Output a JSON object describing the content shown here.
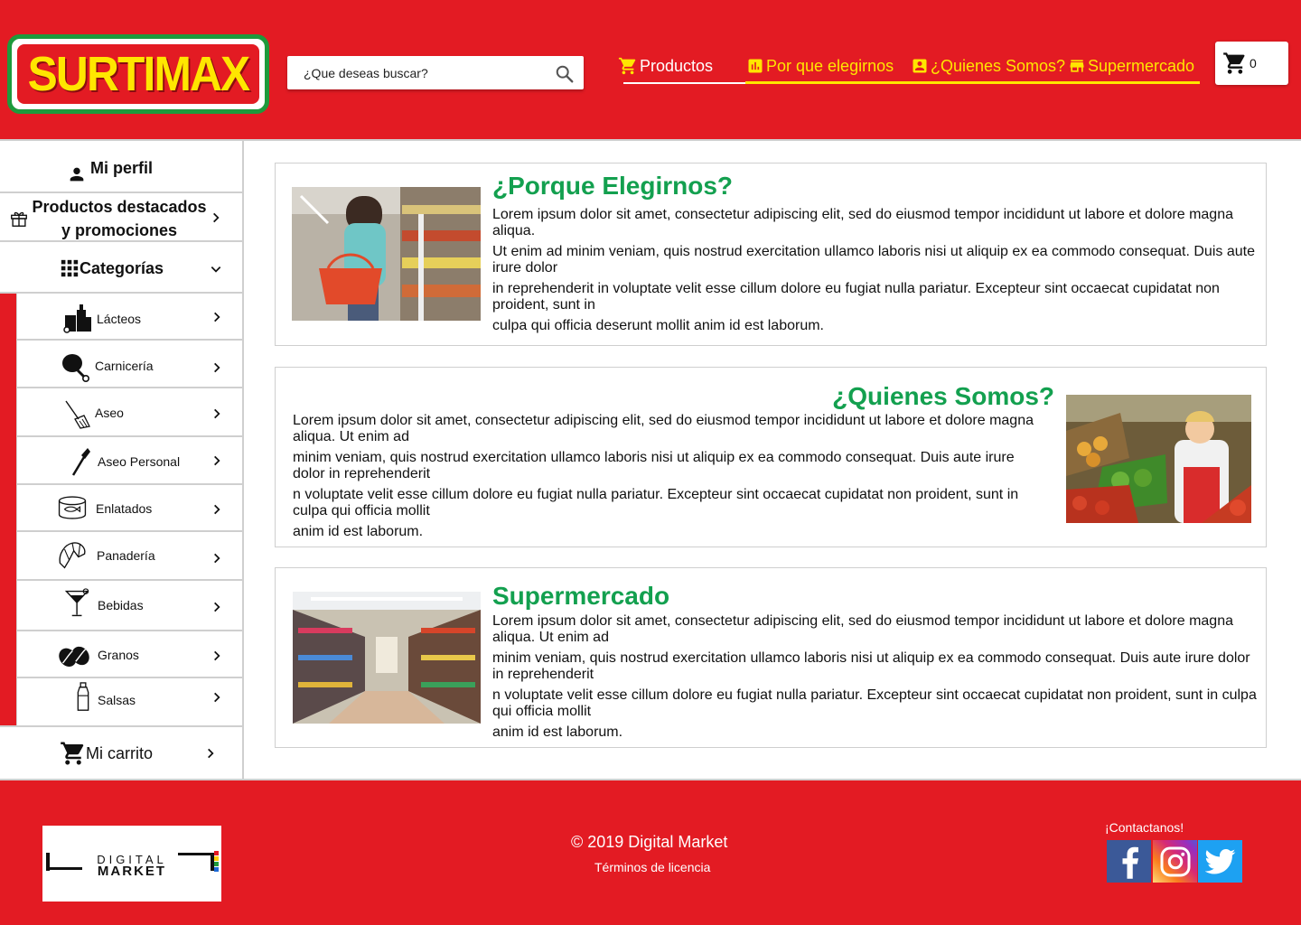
{
  "brand": {
    "name": "SURTIMAX"
  },
  "search": {
    "placeholder": "¿Que deseas buscar?"
  },
  "nav": {
    "items": [
      {
        "label": "Productos",
        "icon": "cart-icon"
      },
      {
        "label": "Por que elegirnos",
        "icon": "chart-icon"
      },
      {
        "label": "¿Quienes Somos?",
        "icon": "contact-card-icon"
      },
      {
        "label": "Supermercado",
        "icon": "store-icon"
      }
    ]
  },
  "cart": {
    "count": "0"
  },
  "sidebar": {
    "profile": "Mi perfil",
    "featured": "Productos destacados y promociones",
    "categories_title": "Categorías",
    "categories": [
      {
        "label": "Lácteos",
        "icon": "dairy-icon"
      },
      {
        "label": "Carnicería",
        "icon": "meat-icon"
      },
      {
        "label": "Aseo",
        "icon": "broom-icon"
      },
      {
        "label": "Aseo Personal",
        "icon": "razor-icon"
      },
      {
        "label": "Enlatados",
        "icon": "canned-food-icon"
      },
      {
        "label": "Panadería",
        "icon": "croissant-icon"
      },
      {
        "label": "Bebidas",
        "icon": "cocktail-icon"
      },
      {
        "label": "Granos",
        "icon": "beans-icon"
      },
      {
        "label": "Salsas",
        "icon": "sauce-bottle-icon"
      }
    ],
    "cart": "Mi carrito"
  },
  "sections": [
    {
      "title": "¿Porque Elegirnos?",
      "paragraphs": [
        "Lorem ipsum dolor sit amet, consectetur adipiscing elit, sed do eiusmod tempor incididunt ut labore et dolore magna aliqua.",
        "Ut enim ad minim veniam, quis nostrud exercitation ullamco laboris nisi ut aliquip ex ea commodo consequat. Duis aute irure dolor",
        "in reprehenderit in voluptate velit esse cillum dolore eu fugiat nulla pariatur. Excepteur sint occaecat cupidatat non proident, sunt in",
        "culpa qui officia deserunt mollit anim id est laborum."
      ]
    },
    {
      "title": "¿Quienes Somos?",
      "paragraphs": [
        " Lorem ipsum dolor sit amet, consectetur adipiscing elit, sed do eiusmod tempor incididunt ut labore et dolore magna aliqua. Ut enim ad",
        " minim veniam, quis nostrud exercitation ullamco laboris nisi ut aliquip ex ea commodo consequat. Duis aute irure dolor in reprehenderit",
        "n voluptate velit esse cillum dolore eu fugiat nulla pariatur. Excepteur sint occaecat cupidatat non proident, sunt in culpa qui officia mollit",
        " anim id est laborum."
      ]
    },
    {
      "title": "Supermercado",
      "paragraphs": [
        " Lorem ipsum dolor sit amet, consectetur adipiscing elit, sed do eiusmod tempor incididunt ut labore et dolore magna aliqua. Ut enim ad",
        " minim veniam, quis nostrud exercitation ullamco laboris nisi ut aliquip ex ea commodo consequat. Duis aute irure dolor in reprehenderit",
        "n voluptate velit esse cillum dolore eu fugiat nulla pariatur. Excepteur sint occaecat cupidatat non proident, sunt in culpa qui officia mollit",
        " anim id est laborum."
      ]
    }
  ],
  "footer": {
    "logo_line1": "DIGITAL",
    "logo_line2": "MARKET",
    "copyright": "© 2019 Digital Market",
    "license": "Términos de licencia",
    "contact": "¡Contactanos!",
    "social": [
      {
        "icon": "facebook-icon",
        "color": "#3b5998"
      },
      {
        "icon": "instagram-icon",
        "color": "#d62976"
      },
      {
        "icon": "twitter-icon",
        "color": "#1da1f2"
      }
    ]
  },
  "colors": {
    "brand_red": "#e31b23",
    "accent_yellow": "#ffe600",
    "title_green": "#13a04f",
    "logo_green": "#1d9a3c"
  }
}
